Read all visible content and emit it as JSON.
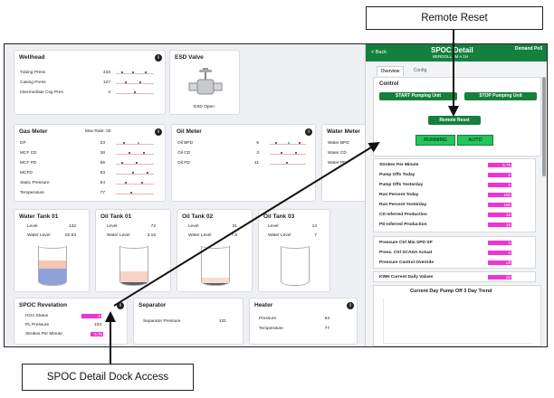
{
  "callouts": {
    "remote_reset": "Remote Reset",
    "spoc_dock": "SPOC Detail Dock Access"
  },
  "colors": {
    "accent_green": "#15803d",
    "status_green": "#22c55e",
    "bar_magenta": "#ee34d3"
  },
  "wellhead": {
    "title": "Wellhead",
    "rows": [
      {
        "label": "Tubing Press",
        "value": "433"
      },
      {
        "label": "Casing Press",
        "value": "127"
      },
      {
        "label": "Intermediate Csg Pres",
        "value": "4"
      }
    ]
  },
  "esd": {
    "title": "ESD Valve",
    "status": "ESD Open",
    "icon": "valve-icon"
  },
  "gas_meter": {
    "title": "Gas Meter",
    "max_rate": "Max Rate: 50",
    "rows": [
      {
        "label": "DP",
        "value": "23"
      },
      {
        "label": "MCF CD",
        "value": "36"
      },
      {
        "label": "MCF PD",
        "value": "66"
      },
      {
        "label": "MCFD",
        "value": "63"
      },
      {
        "label": "Static Pressure",
        "value": "54"
      },
      {
        "label": "Temperature",
        "value": "77"
      }
    ]
  },
  "oil_meter": {
    "title": "Oil Meter",
    "rows": [
      {
        "label": "Oil BPD",
        "value": "6"
      },
      {
        "label": "Oil CD",
        "value": "3"
      },
      {
        "label": "Oil PD",
        "value": "11"
      }
    ]
  },
  "water_meter": {
    "title": "Water Meter",
    "rows": [
      {
        "label": "Water BPD"
      },
      {
        "label": "Water CD"
      },
      {
        "label": "Water PD"
      }
    ]
  },
  "tanks": [
    {
      "title": "Water Tank 01",
      "level_label": "Level",
      "level": "132",
      "wl_label": "Water Level",
      "water_level": "82.53",
      "fill_fraction": 0.62,
      "water_fraction": 0.42
    },
    {
      "title": "Oil Tank 01",
      "level_label": "Level",
      "level": "72",
      "wl_label": "Water Level",
      "water_level": "3.15",
      "fill_fraction": 0.36,
      "water_fraction": 0.06
    },
    {
      "title": "Oil Tank 02",
      "level_label": "Level",
      "level": "31",
      "wl_label": "Water Level",
      "water_level": "7.5",
      "fill_fraction": 0.18,
      "water_fraction": 0.05
    },
    {
      "title": "Oil Tank 03",
      "level_label": "Level",
      "level": "13",
      "wl_label": "Water Level",
      "water_level": "7",
      "fill_fraction": 0.0,
      "water_fraction": 0.0
    }
  ],
  "revelation": {
    "title": "SPOC Revelation",
    "rows": [
      {
        "label": "HOA Status",
        "value": "5"
      },
      {
        "label": "PL Pressure",
        "value": "103"
      },
      {
        "label": "Strokes Per Minute",
        "value": "5.75"
      }
    ]
  },
  "separator": {
    "title": "Separator",
    "rows": [
      {
        "label": "Separator Pressure",
        "value": "131"
      }
    ]
  },
  "heater": {
    "title": "Heater",
    "rows": [
      {
        "label": "Pressure",
        "value": "54"
      },
      {
        "label": "Temperature",
        "value": "77"
      }
    ]
  },
  "spoc_detail": {
    "back": "< Back",
    "title": "SPOC Detail",
    "subtitle": "BERDOLL 5M A 1H",
    "demand_poll": "Demand Poll",
    "tabs": [
      "Overview",
      "Config"
    ],
    "control_label": "Control",
    "start_btn": "START Pumping Unit",
    "stop_btn": "STOP Pumping Unit",
    "reset_btn": "Remote Reset",
    "status_running": "RUNNING",
    "status_mode": "AUTO",
    "stats": [
      {
        "label": "Strokes Per Minute",
        "value": "5.75"
      },
      {
        "label": "Pump Offs Today",
        "value": "0"
      },
      {
        "label": "Pump Offs Yesterday",
        "value": "0"
      },
      {
        "label": "Run Percent Today",
        "value": "100"
      },
      {
        "label": "Run Percent Yesterday",
        "value": "100"
      },
      {
        "label": "CD Inferred Production",
        "value": "16"
      },
      {
        "label": "PD Inferred Production",
        "value": "16"
      }
    ],
    "pressure": [
      {
        "label": "Pressure Ctrl Min SPD SP",
        "value": "0"
      },
      {
        "label": "Press. Ctrl SCADA Actual",
        "value": "0"
      },
      {
        "label": "Pressure Control Override",
        "value": "off"
      }
    ],
    "kwh_label": "KWH Current Daily Values",
    "kwh_value": "20",
    "trend_title": "Current Day Pump Off 3 Day Trend"
  }
}
